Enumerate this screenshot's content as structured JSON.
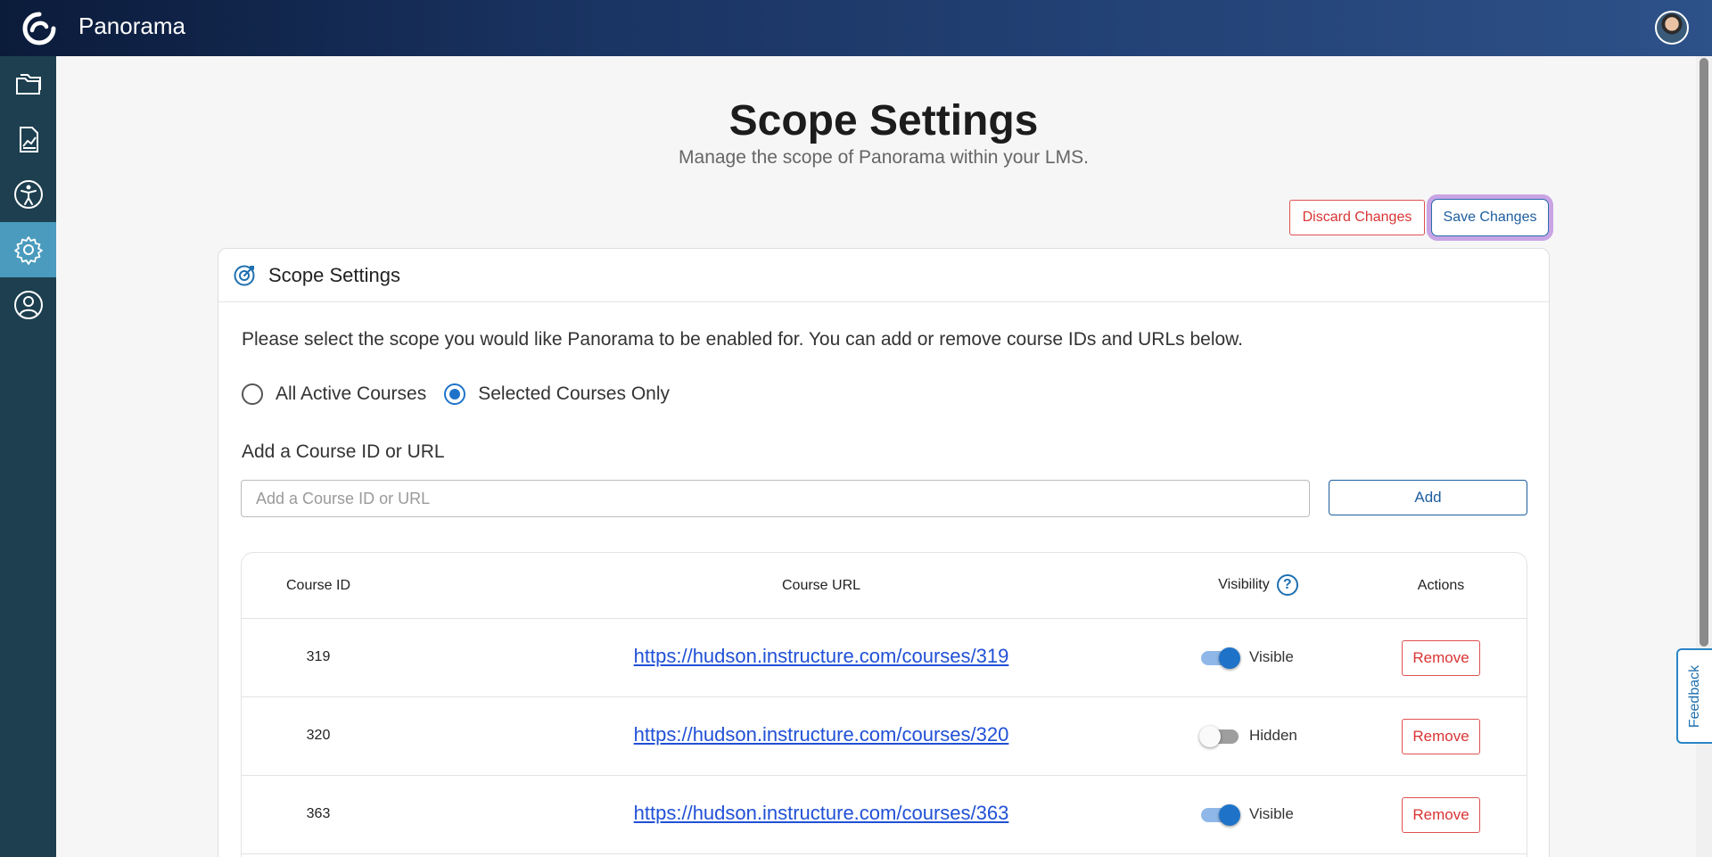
{
  "app": {
    "title": "Panorama"
  },
  "sidebar": {
    "items": [
      {
        "name": "courses",
        "icon": "folders-icon"
      },
      {
        "name": "reports",
        "icon": "chart-report-icon"
      },
      {
        "name": "accessibility",
        "icon": "accessibility-icon"
      },
      {
        "name": "settings",
        "icon": "gear-icon",
        "active": true
      },
      {
        "name": "account",
        "icon": "user-circle-icon"
      }
    ]
  },
  "page": {
    "title": "Scope Settings",
    "subtitle": "Manage the scope of Panorama within your LMS."
  },
  "actions": {
    "discard_label": "Discard Changes",
    "save_label": "Save Changes"
  },
  "card": {
    "title": "Scope Settings",
    "icon": "target-icon",
    "description": "Please select the scope you would like Panorama to be enabled for. You can add or remove course IDs and URLs below.",
    "scope_options": [
      {
        "label": "All Active Courses",
        "checked": false
      },
      {
        "label": "Selected Courses Only",
        "checked": true
      }
    ],
    "add_label": "Add a Course ID or URL",
    "add_placeholder": "Add a Course ID or URL",
    "add_value": "",
    "add_button": "Add"
  },
  "table": {
    "columns": [
      "Course ID",
      "Course URL",
      "Visibility",
      "Actions"
    ],
    "rows": [
      {
        "id": "319",
        "url": "https://hudson.instructure.com/courses/319",
        "visible": true,
        "visibility_label": "Visible",
        "action": "Remove"
      },
      {
        "id": "320",
        "url": "https://hudson.instructure.com/courses/320",
        "visible": false,
        "visibility_label": "Hidden",
        "action": "Remove"
      },
      {
        "id": "363",
        "url": "https://hudson.instructure.com/courses/363",
        "visible": true,
        "visibility_label": "Visible",
        "action": "Remove"
      }
    ]
  },
  "feedback": {
    "label": "Feedback"
  },
  "colors": {
    "sidebar_bg": "#1d3f4f",
    "sidebar_active": "#4a9bbd",
    "primary": "#1d5e9f",
    "danger": "#d93434",
    "link": "#2050d6",
    "save_focus_ring": "#c8a4e4"
  }
}
